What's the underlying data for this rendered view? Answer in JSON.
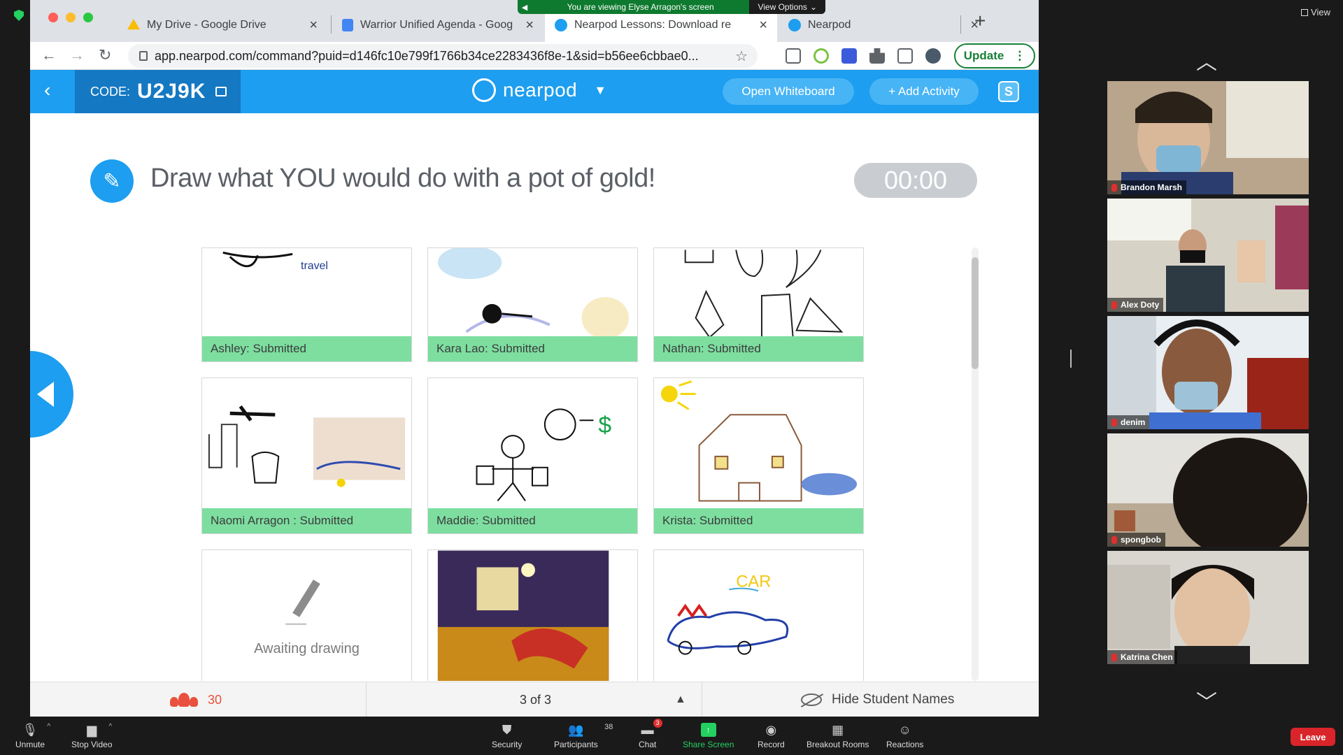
{
  "zoom": {
    "share_banner": "You are viewing Elyse Arragon's screen",
    "view_options": "View Options",
    "view_label": "View",
    "participants": [
      {
        "name": "Brandon Marsh"
      },
      {
        "name": "Alex Doty"
      },
      {
        "name": "denim"
      },
      {
        "name": "spongbob"
      },
      {
        "name": "Katrina Chen"
      }
    ],
    "controls": {
      "unmute": "Unmute",
      "stop_video": "Stop Video",
      "security": "Security",
      "participants": "Participants",
      "participants_count": "38",
      "chat": "Chat",
      "chat_badge": "3",
      "share_screen": "Share Screen",
      "record": "Record",
      "breakout_rooms": "Breakout Rooms",
      "reactions": "Reactions",
      "leave": "Leave"
    }
  },
  "browser": {
    "tabs": [
      {
        "title": "My Drive - Google Drive",
        "favicon_color": "#fbbc04"
      },
      {
        "title": "Warrior Unified Agenda - Goog",
        "favicon_color": "#4285f4"
      },
      {
        "title": "Nearpod Lessons: Download re",
        "favicon_color": "#1d9ef0"
      },
      {
        "title": "Nearpod",
        "favicon_color": "#1d9ef0"
      }
    ],
    "url": "app.nearpod.com/command?puid=d146fc10e799f1766b34ce2283436f8e-1&sid=b56ee6cbbae0...",
    "update_label": "Update"
  },
  "nearpod": {
    "code_label": "CODE:",
    "code_value": "U2J9K",
    "brand": "nearpod",
    "open_whiteboard": "Open Whiteboard",
    "add_activity": "+ Add Activity",
    "s_badge": "S",
    "question": "Draw what YOU would do with a pot of gold!",
    "timer": "00:00",
    "submissions": [
      {
        "label": "Ashley: Submitted",
        "caption": "travel"
      },
      {
        "label": "Kara Lao: Submitted"
      },
      {
        "label": "Nathan: Submitted"
      },
      {
        "label": "Naomi Arragon : Submitted"
      },
      {
        "label": "Maddie: Submitted"
      },
      {
        "label": "Krista: Submitted"
      },
      {
        "label": "",
        "awaiting": "Awaiting drawing"
      },
      {
        "label": ""
      },
      {
        "label": "",
        "caption": "CAR"
      }
    ],
    "footer": {
      "students_count": "30",
      "pager": "3 of 3",
      "hide_names": "Hide Student Names"
    }
  },
  "colors": {
    "nearpod_blue": "#1d9ef0",
    "submitted_green": "#7ddea0",
    "leave_red": "#d9252a"
  }
}
